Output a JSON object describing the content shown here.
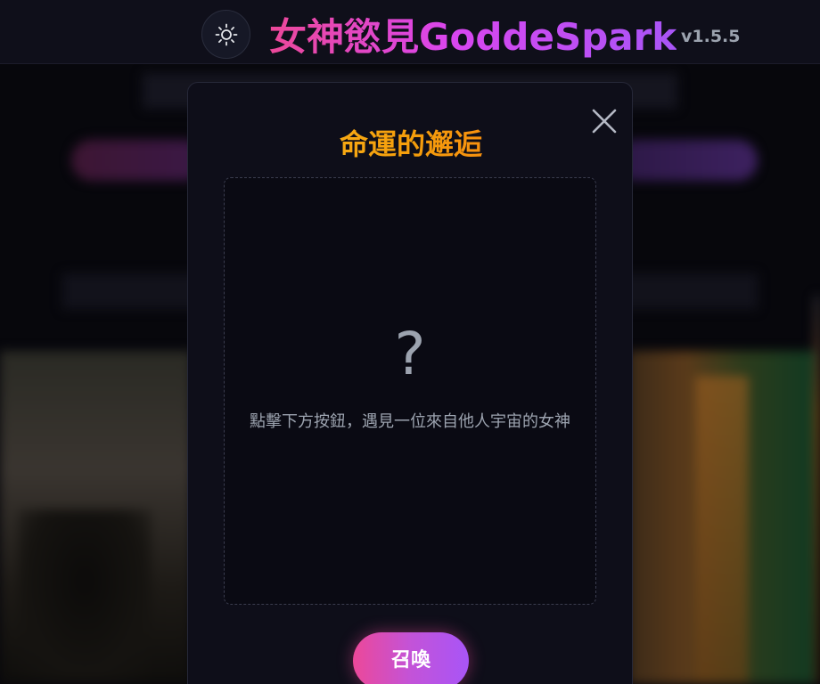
{
  "header": {
    "title": "女神慾見GoddeSpark",
    "version": "v1.5.5",
    "theme_icon": "sun-icon"
  },
  "modal": {
    "title": "命運的邂逅",
    "close_icon": "close-icon",
    "card": {
      "placeholder_symbol": "?",
      "hint": "點擊下方按鈕，遇見一位來自他人宇宙的女神"
    },
    "summon_label": "召喚"
  },
  "colors": {
    "title_gradient": [
      "#ec4899",
      "#a855f7"
    ],
    "modal_title_gradient": [
      "#fbbf24",
      "#f97316"
    ],
    "button_gradient": [
      "#ec4899",
      "#a855f7"
    ],
    "background": "#07070c",
    "modal_background": "#0e0e19"
  }
}
